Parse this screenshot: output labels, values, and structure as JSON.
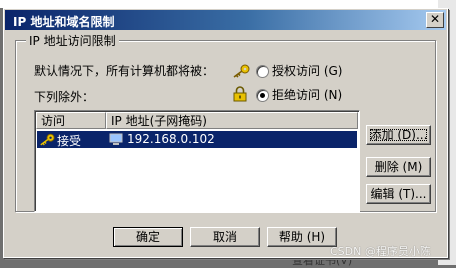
{
  "window": {
    "title": "IP 地址和域名限制",
    "close_glyph": "✕"
  },
  "group": {
    "title": "IP 地址访问限制",
    "default_text": "默认情况下，所有计算机都将被：",
    "radio_grant": "授权访问 (G)",
    "except_text": "下列除外：",
    "radio_deny": "拒绝访问 (N)",
    "selected_radio": "deny"
  },
  "listview": {
    "columns": [
      "访问",
      "IP 地址(子网掩码)"
    ],
    "rows": [
      {
        "access": "接受",
        "ip": "192.168.0.102",
        "selected": true
      }
    ]
  },
  "side_buttons": {
    "add": "添加 (D)...",
    "delete": "删除 (M)",
    "edit": "编辑 (T)..."
  },
  "footer": {
    "ok": "确定",
    "cancel": "取消",
    "help": "帮助 (H)"
  },
  "background": {
    "partial_text": "查看证书(V)"
  },
  "watermark": "CSDN @程序员小陈",
  "icons": {
    "key": "key-icon",
    "lock": "lock-icon",
    "computer": "computer-icon"
  },
  "colors": {
    "title_start": "#0a246a",
    "title_end": "#a6caf0",
    "selection": "#0a246a",
    "face": "#d4d0c8"
  }
}
